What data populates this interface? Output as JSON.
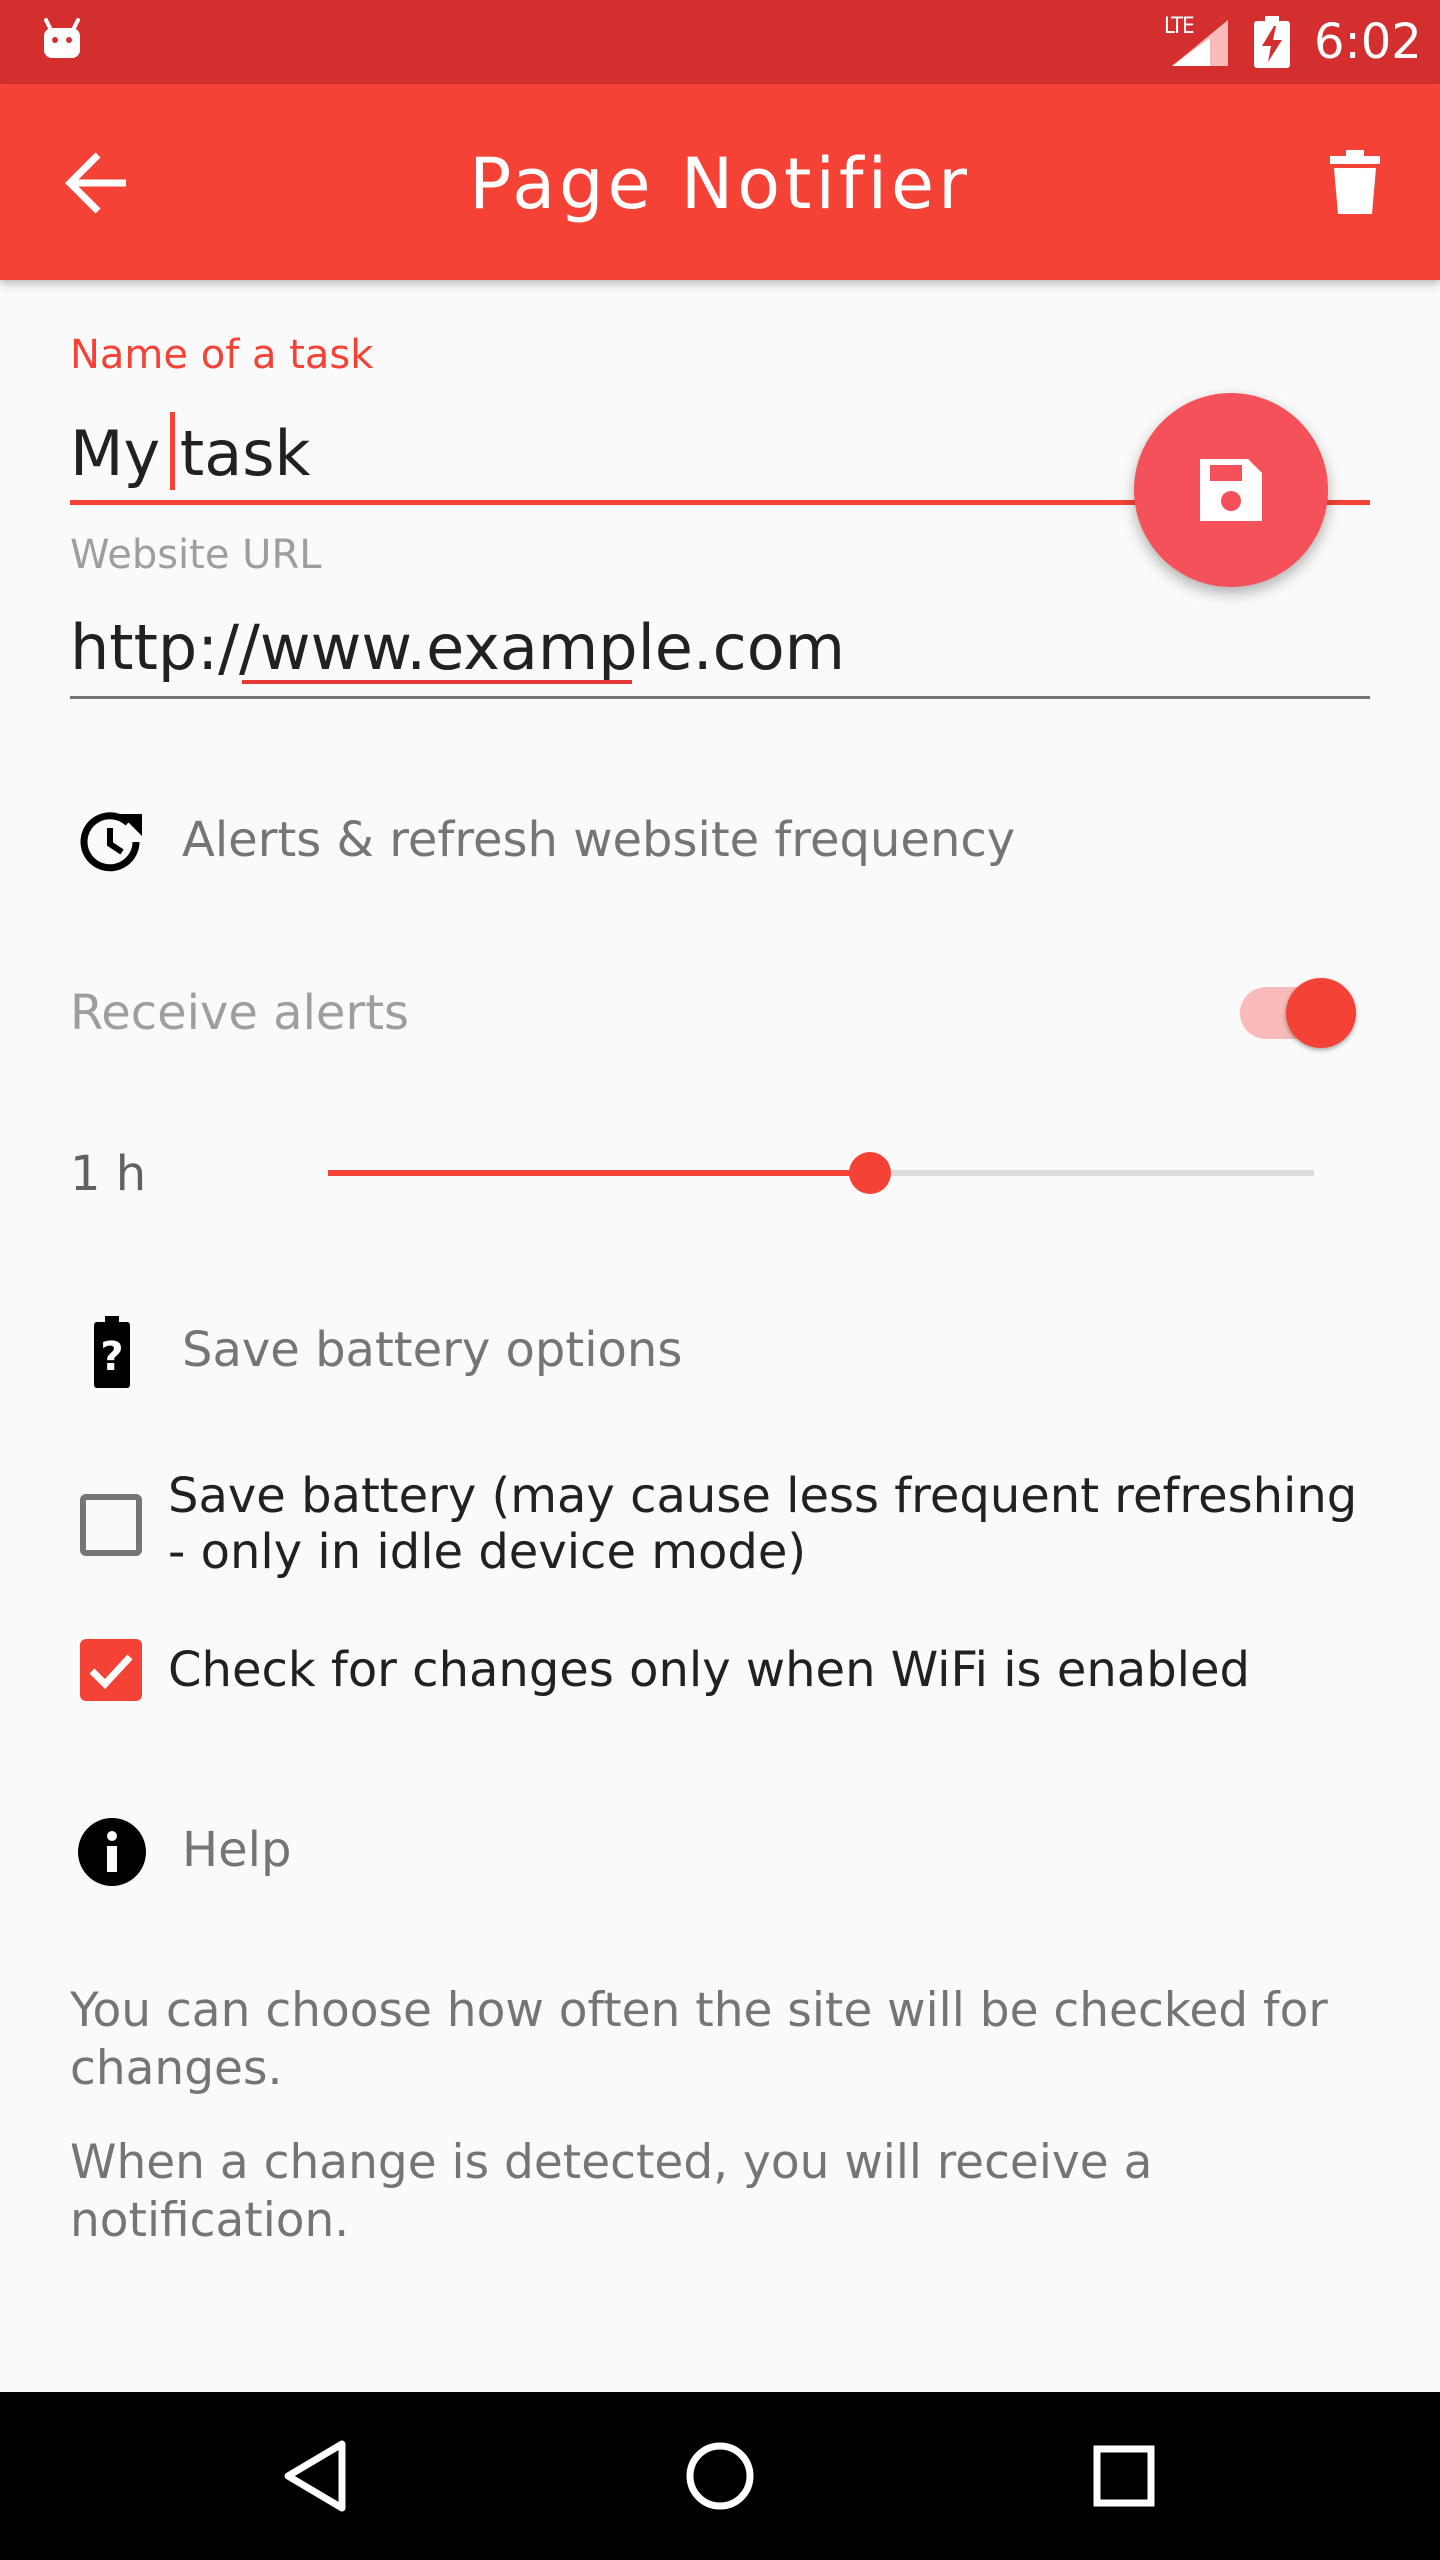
{
  "status_bar": {
    "time": "6:02",
    "network_label": "LTE",
    "icons": [
      "android-icon",
      "signal-icon",
      "battery-charging-icon"
    ]
  },
  "toolbar": {
    "title": "Page Notifier",
    "back_icon": "arrow-back-icon",
    "delete_icon": "trash-icon"
  },
  "form": {
    "task_label": "Name of a task",
    "task_value": "My task",
    "url_label": "Website URL",
    "url_value": "http://www.example.com",
    "save_icon": "floppy-disk-icon"
  },
  "alerts_section": {
    "title": "Alerts & refresh website frequency",
    "icon": "clock-refresh-icon",
    "receive_alerts_label": "Receive alerts",
    "receive_alerts_on": true,
    "frequency_label": "1 h",
    "frequency_level": 0.55
  },
  "battery_section": {
    "title": "Save battery options",
    "icon": "battery-unknown-icon",
    "options": [
      {
        "label": "Save battery (may cause less frequent refreshing - only in idle device mode)",
        "checked": false
      },
      {
        "label": "Check for changes only when WiFi is enabled",
        "checked": true
      }
    ]
  },
  "help_section": {
    "title": "Help",
    "icon": "info-icon",
    "paragraphs": [
      "You can choose how often the site will be checked for changes.",
      "When a change is detected, you will receive a notification."
    ]
  },
  "nav_bar": {
    "icons": [
      "back-triangle-icon",
      "home-circle-icon",
      "recents-square-icon"
    ]
  },
  "colors": {
    "status_bar": "#D32F2F",
    "toolbar": "#F44336",
    "accent": "#F44336",
    "fab": "#F4515A"
  }
}
